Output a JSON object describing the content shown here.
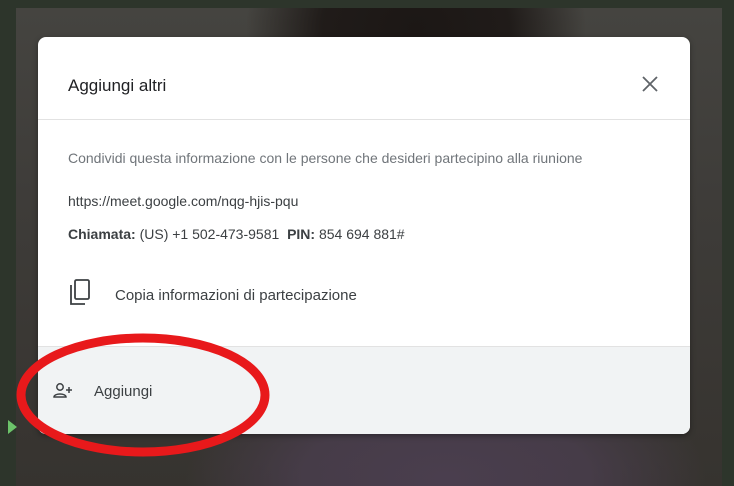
{
  "dialog": {
    "title": "Aggiungi altri",
    "description": "Condividi questa informazione con le persone che desideri partecipino alla riunione",
    "meeting_link": "https://meet.google.com/nqg-hjis-pqu",
    "call_label": "Chiamata:",
    "call_number": "(US) +1 502-473-9581",
    "pin_label": "PIN:",
    "pin_value": "854 694 881#",
    "copy_label": "Copia informazioni di partecipazione",
    "add_label": "Aggiungi",
    "icons": {
      "close": "close-icon",
      "copy": "copy-icon",
      "add_person": "add-person-icon"
    }
  },
  "annotation": {
    "color": "#e8191b",
    "shape": "ellipse"
  }
}
